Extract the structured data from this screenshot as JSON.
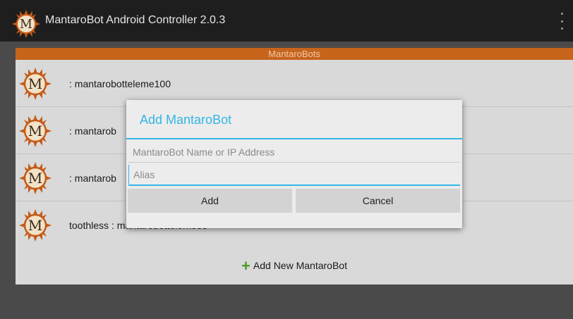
{
  "app": {
    "title": "MantaroBot Android Controller 2.0.3"
  },
  "list": {
    "header": "MantaroBots",
    "items": [
      {
        "label": ": mantarobotteleme100"
      },
      {
        "label": ": mantarob"
      },
      {
        "label": ": mantarob"
      },
      {
        "label": "toothless : mantarobotteleme83"
      }
    ],
    "add_new_label": "Add New MantaroBot"
  },
  "dialog": {
    "title": "Add MantaroBot",
    "name_field": {
      "placeholder": "MantaroBot Name or IP Address",
      "value": ""
    },
    "alias_field": {
      "placeholder": "Alias",
      "value": ""
    },
    "add_label": "Add",
    "cancel_label": "Cancel"
  },
  "colors": {
    "accent": "#33b5e5",
    "header_bar": "#c6641c",
    "add_icon": "#4c9a2a"
  },
  "icons": {
    "logo": "mantarobot-sun-logo-icon",
    "menu": "overflow-menu-icon",
    "add": "plus-icon"
  }
}
